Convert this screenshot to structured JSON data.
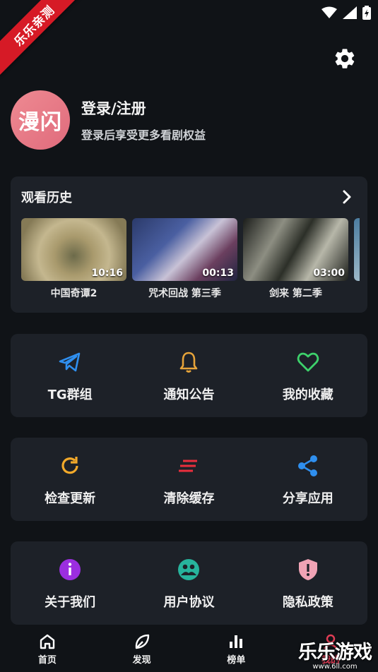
{
  "ribbon": {
    "label": "乐乐亲测"
  },
  "profile": {
    "avatar_text": "漫闪",
    "title": "登录/注册",
    "subtitle": "登录后享受更多看剧权益"
  },
  "history": {
    "header": "观看历史",
    "items": [
      {
        "title": "中国奇谭2",
        "duration": "10:16"
      },
      {
        "title": "咒术回战 第三季",
        "duration": "00:13"
      },
      {
        "title": "剑来 第二季",
        "duration": "03:00"
      }
    ]
  },
  "grid": {
    "row1": [
      {
        "label": "TG群组",
        "icon": "telegram-icon",
        "color": "#2f8fef"
      },
      {
        "label": "通知公告",
        "icon": "bell-icon",
        "color": "#e7a43a"
      },
      {
        "label": "我的收藏",
        "icon": "heart-icon",
        "color": "#3dd16b"
      }
    ],
    "row2": [
      {
        "label": "检查更新",
        "icon": "refresh-icon",
        "color": "#f2a92a"
      },
      {
        "label": "清除缓存",
        "icon": "clear-lines-icon",
        "color": "#ea2e3d"
      },
      {
        "label": "分享应用",
        "icon": "share-icon",
        "color": "#2f8fef"
      }
    ],
    "row3": [
      {
        "label": "关于我们",
        "icon": "info-icon",
        "color": "#9b2ee0"
      },
      {
        "label": "用户协议",
        "icon": "group-icon",
        "color": "#27b39c"
      },
      {
        "label": "隐私政策",
        "icon": "shield-icon",
        "color": "#f0a3b5"
      }
    ]
  },
  "nav": [
    {
      "label": "首页",
      "icon": "home-icon"
    },
    {
      "label": "发现",
      "icon": "leaf-icon"
    },
    {
      "label": "榜单",
      "icon": "bar-chart-icon"
    },
    {
      "label": "我的",
      "icon": "user-icon"
    }
  ],
  "watermark": {
    "text": "乐乐游戏",
    "url": "www.6ll.com"
  }
}
